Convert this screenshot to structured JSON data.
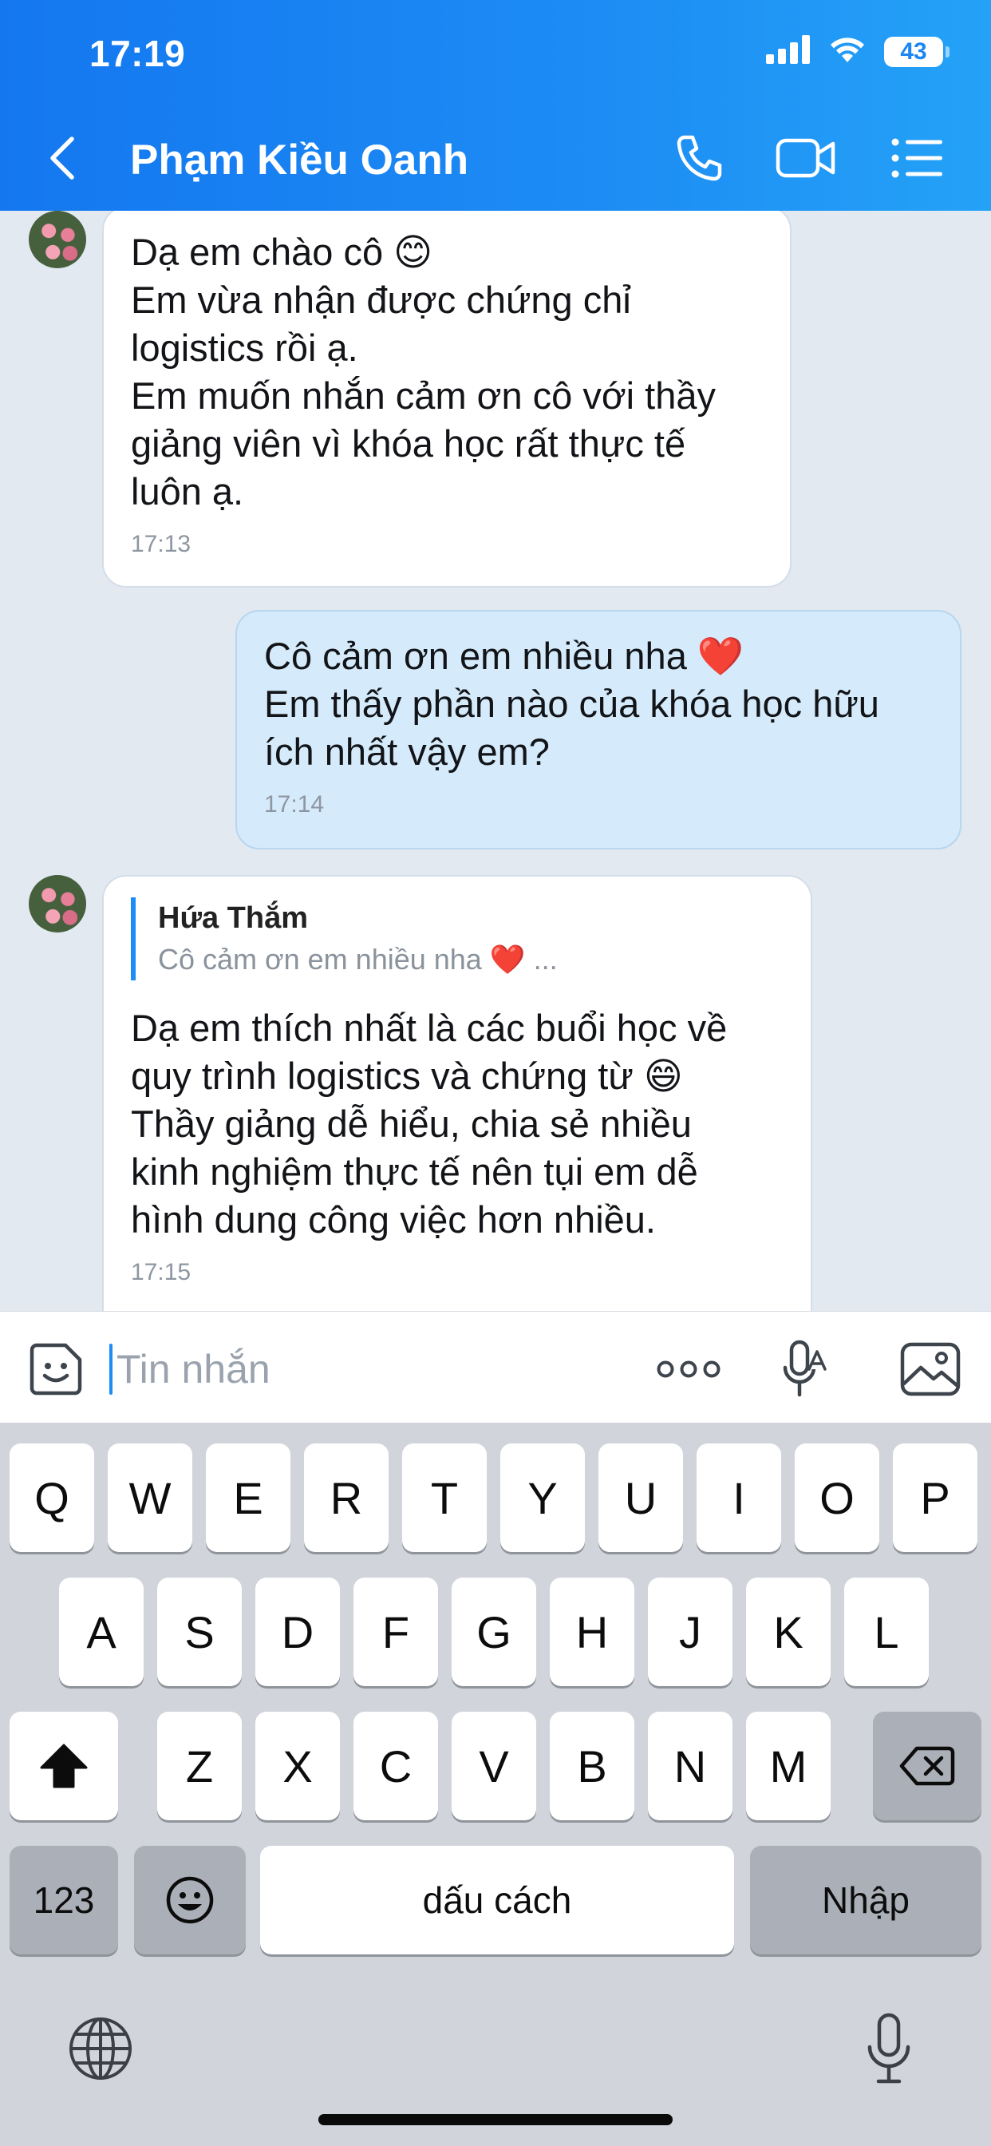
{
  "status_bar": {
    "time": "17:19",
    "battery": "43"
  },
  "header": {
    "back_icon": "chevron-left-icon",
    "contact_name": "Phạm Kiều Oanh",
    "actions": [
      "phone-icon",
      "video-call-icon",
      "menu-list-icon"
    ]
  },
  "messages": [
    {
      "sender": "them",
      "text": "Dạ em chào cô 😊\nEm vừa nhận được chứng chỉ\nlogistics rồi ạ.\nEm muốn nhắn cảm ơn cô với thầy\ngiảng viên vì khóa học rất thực tế\nluôn ạ.",
      "time": "17:13"
    },
    {
      "sender": "me",
      "text": "Cô cảm ơn em nhiều nha ❤️\nEm thấy phần nào của khóa học hữu\ních nhất vậy em?",
      "time": "17:14"
    },
    {
      "sender": "them",
      "quote": {
        "author": "Hứa Thắm",
        "text": "Cô cảm ơn em nhiều nha ❤️ ..."
      },
      "text": "Dạ em thích nhất là các buổi học về\nquy trình logistics và chứng từ 😄\nThầy giảng dễ hiểu, chia sẻ nhiều\nkinh nghiệm thực tế nên tụi em dễ\nhình dung công việc hơn nhiều.",
      "time": "17:15"
    }
  ],
  "input_bar": {
    "placeholder": "Tin nhắn",
    "icons": [
      "sticker-icon",
      "more-dots-icon",
      "voice-to-text-icon",
      "image-icon"
    ]
  },
  "keyboard": {
    "row1": [
      "Q",
      "W",
      "E",
      "R",
      "T",
      "Y",
      "U",
      "I",
      "O",
      "P"
    ],
    "row2": [
      "A",
      "S",
      "D",
      "F",
      "G",
      "H",
      "J",
      "K",
      "L"
    ],
    "row3": [
      "Z",
      "X",
      "C",
      "V",
      "B",
      "N",
      "M"
    ],
    "numbers_key": "123",
    "space_label": "dấu cách",
    "return_label": "Nhập"
  },
  "colors": {
    "header_start": "#1477f0",
    "header_end": "#24a2f7",
    "chat_background": "#e2e9f1",
    "my_bubble": "#d5ebfb",
    "their_bubble": "#ffffff",
    "quote_bar": "#1d8cf4"
  }
}
